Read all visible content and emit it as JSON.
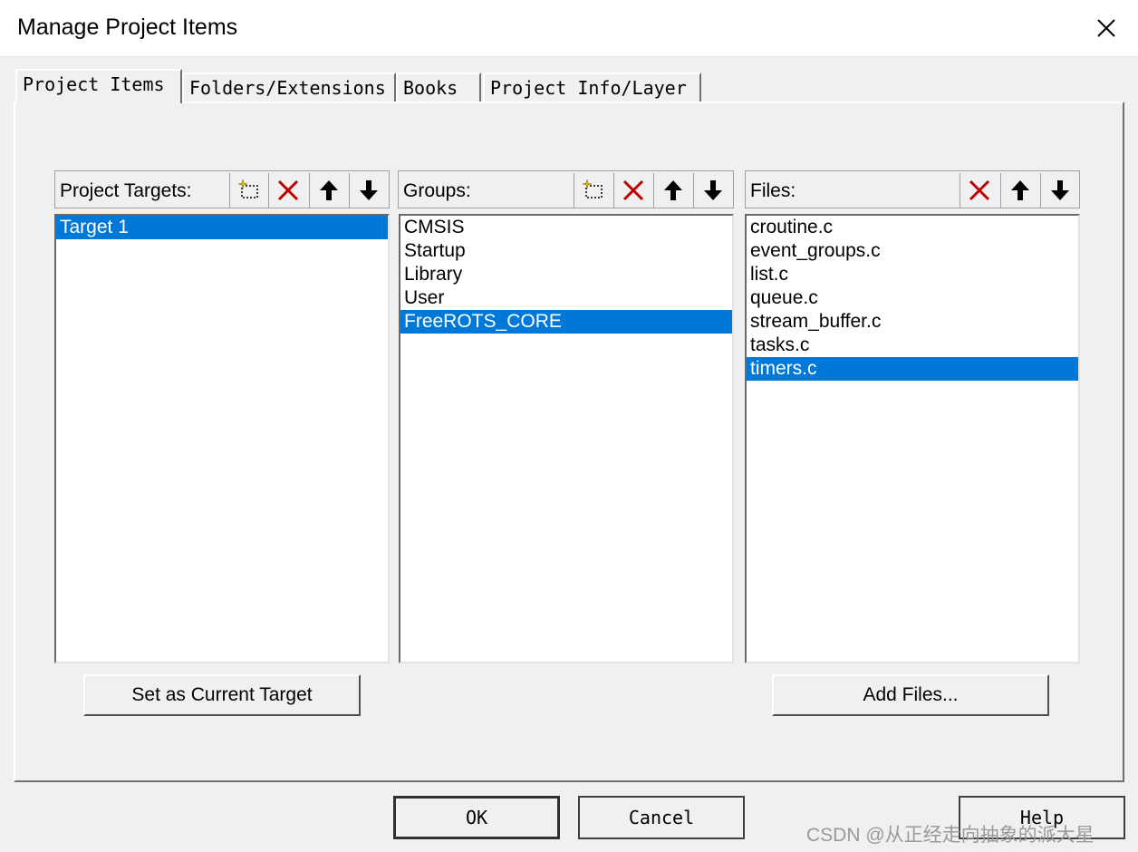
{
  "window": {
    "title": "Manage Project Items"
  },
  "tabs": [
    {
      "label": "Project Items",
      "active": true
    },
    {
      "label": "Folders/Extensions",
      "active": false
    },
    {
      "label": "Books",
      "active": false
    },
    {
      "label": "Project Info/Layer",
      "active": false
    }
  ],
  "targets": {
    "label": "Project Targets:",
    "items": [
      "Target 1"
    ],
    "selected_index": 0,
    "toolbar_icons": [
      "new-icon",
      "delete-icon",
      "move-up-icon",
      "move-down-icon"
    ],
    "action_button": "Set as Current Target"
  },
  "groups": {
    "label": "Groups:",
    "items": [
      "CMSIS",
      "Startup",
      "Library",
      "User",
      "FreeROTS_CORE"
    ],
    "selected_index": 4,
    "toolbar_icons": [
      "new-icon",
      "delete-icon",
      "move-up-icon",
      "move-down-icon"
    ]
  },
  "files": {
    "label": "Files:",
    "items": [
      "croutine.c",
      "event_groups.c",
      "list.c",
      "queue.c",
      "stream_buffer.c",
      "tasks.c",
      "timers.c"
    ],
    "selected_index": 6,
    "toolbar_icons": [
      "delete-icon",
      "move-up-icon",
      "move-down-icon"
    ],
    "action_button": "Add Files..."
  },
  "footer": {
    "ok": "OK",
    "cancel": "Cancel",
    "help": "Help"
  },
  "watermark": "CSDN @从正经走向抽象的派大星",
  "colors": {
    "selection": "#0078d7",
    "delete_icon": "#c00000"
  }
}
